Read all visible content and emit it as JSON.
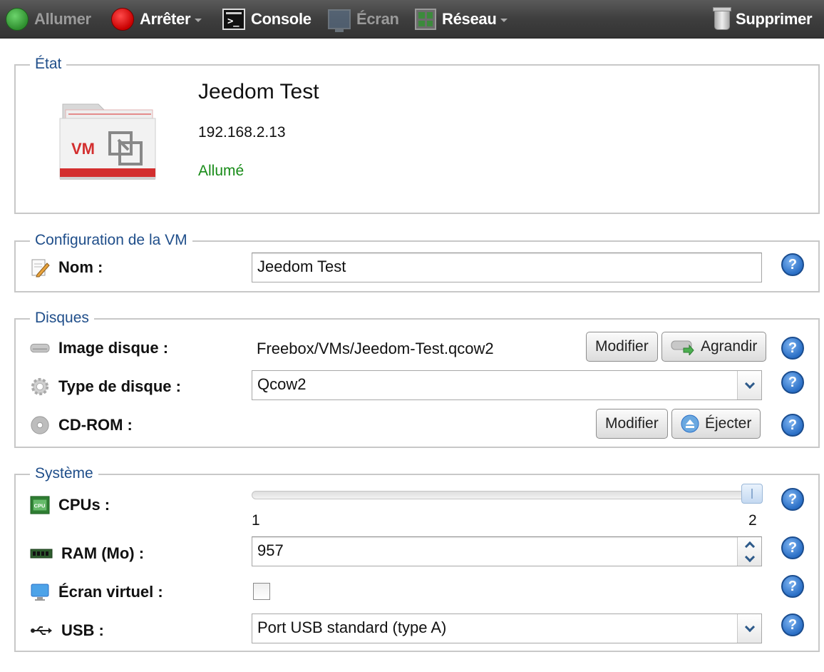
{
  "toolbar": {
    "allumer": "Allumer",
    "arreter": "Arrêter",
    "console": "Console",
    "ecran": "Écran",
    "reseau": "Réseau",
    "supprimer": "Supprimer"
  },
  "etat": {
    "legend": "État",
    "logo_text": "VM",
    "vm_name": "Jeedom Test",
    "ip": "192.168.2.13",
    "status": "Allumé",
    "status_color": "#178b17"
  },
  "config": {
    "legend": "Configuration de la VM",
    "nom_label": "Nom :",
    "nom_value": "Jeedom Test"
  },
  "disques": {
    "legend": "Disques",
    "image_label": "Image disque :",
    "image_value": "Freebox/VMs/Jeedom-Test.qcow2",
    "modifier_label": "Modifier",
    "agrandir_label": "Agrandir",
    "type_label": "Type de disque :",
    "type_value": "Qcow2",
    "cdrom_label": "CD-ROM :",
    "cdrom_modifier_label": "Modifier",
    "ejecter_label": "Éjecter"
  },
  "systeme": {
    "legend": "Système",
    "cpus_label": "CPUs :",
    "cpu_icon_text": "CPU",
    "cpus_min": "1",
    "cpus_max": "2",
    "cpus_value": 2,
    "ram_label": "RAM (Mo) :",
    "ram_value": "957",
    "ecran_label": "Écran virtuel :",
    "ecran_checked": false,
    "usb_label": "USB :",
    "usb_value": "Port USB standard (type A)"
  },
  "help_symbol": "?"
}
